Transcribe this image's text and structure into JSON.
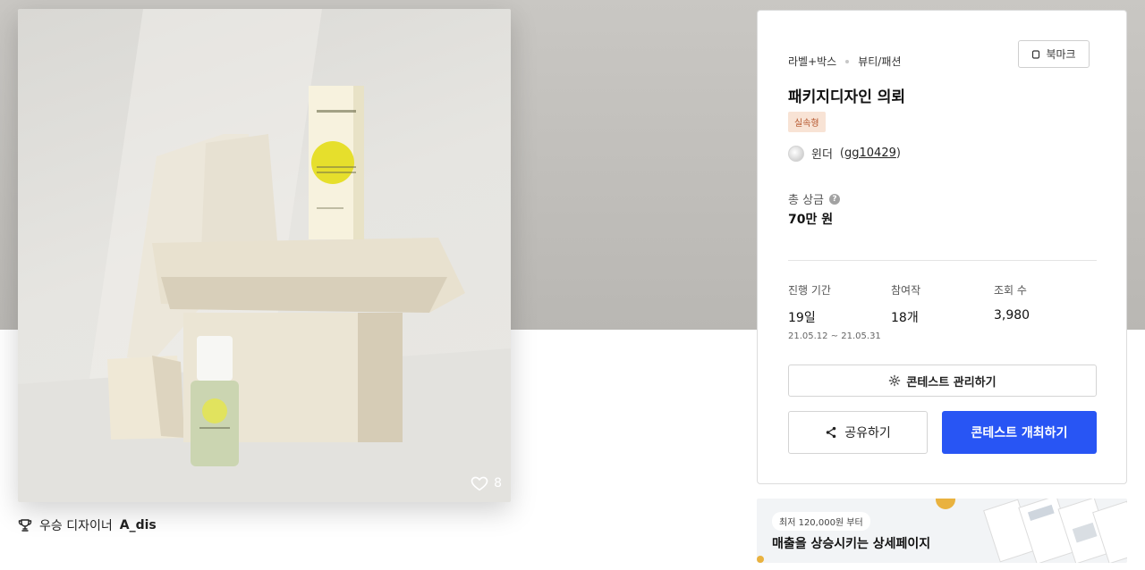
{
  "hero": {
    "likes_count": "8"
  },
  "winner": {
    "prefix": "우승 디자이너",
    "name": "A_dis"
  },
  "card": {
    "categories": [
      "라벨+박스",
      "뷰티/패션"
    ],
    "bookmark_label": "북마크",
    "title": "패키지디자인 의뢰",
    "badge": "실속형",
    "host_name": "윈더",
    "host_id": "gg10429",
    "prize_label": "총 상금",
    "prize_value": "70만 원",
    "stats": {
      "period_label": "진행 기간",
      "period_value": "19일",
      "period_range": "21.05.12 ~ 21.05.31",
      "entries_label": "참여작",
      "entries_value": "18개",
      "views_label": "조회 수",
      "views_value": "3,980"
    },
    "manage_label": "콘테스트 관리하기",
    "share_label": "공유하기",
    "open_label": "콘테스트 개최하기"
  },
  "ad": {
    "pill": "최저 120,000원 부터",
    "title": "매출을 상승시키는 상세페이지"
  },
  "colors": {
    "primary": "#2855f4",
    "badge_bg": "#f8e3d5",
    "badge_text": "#b5562d"
  }
}
